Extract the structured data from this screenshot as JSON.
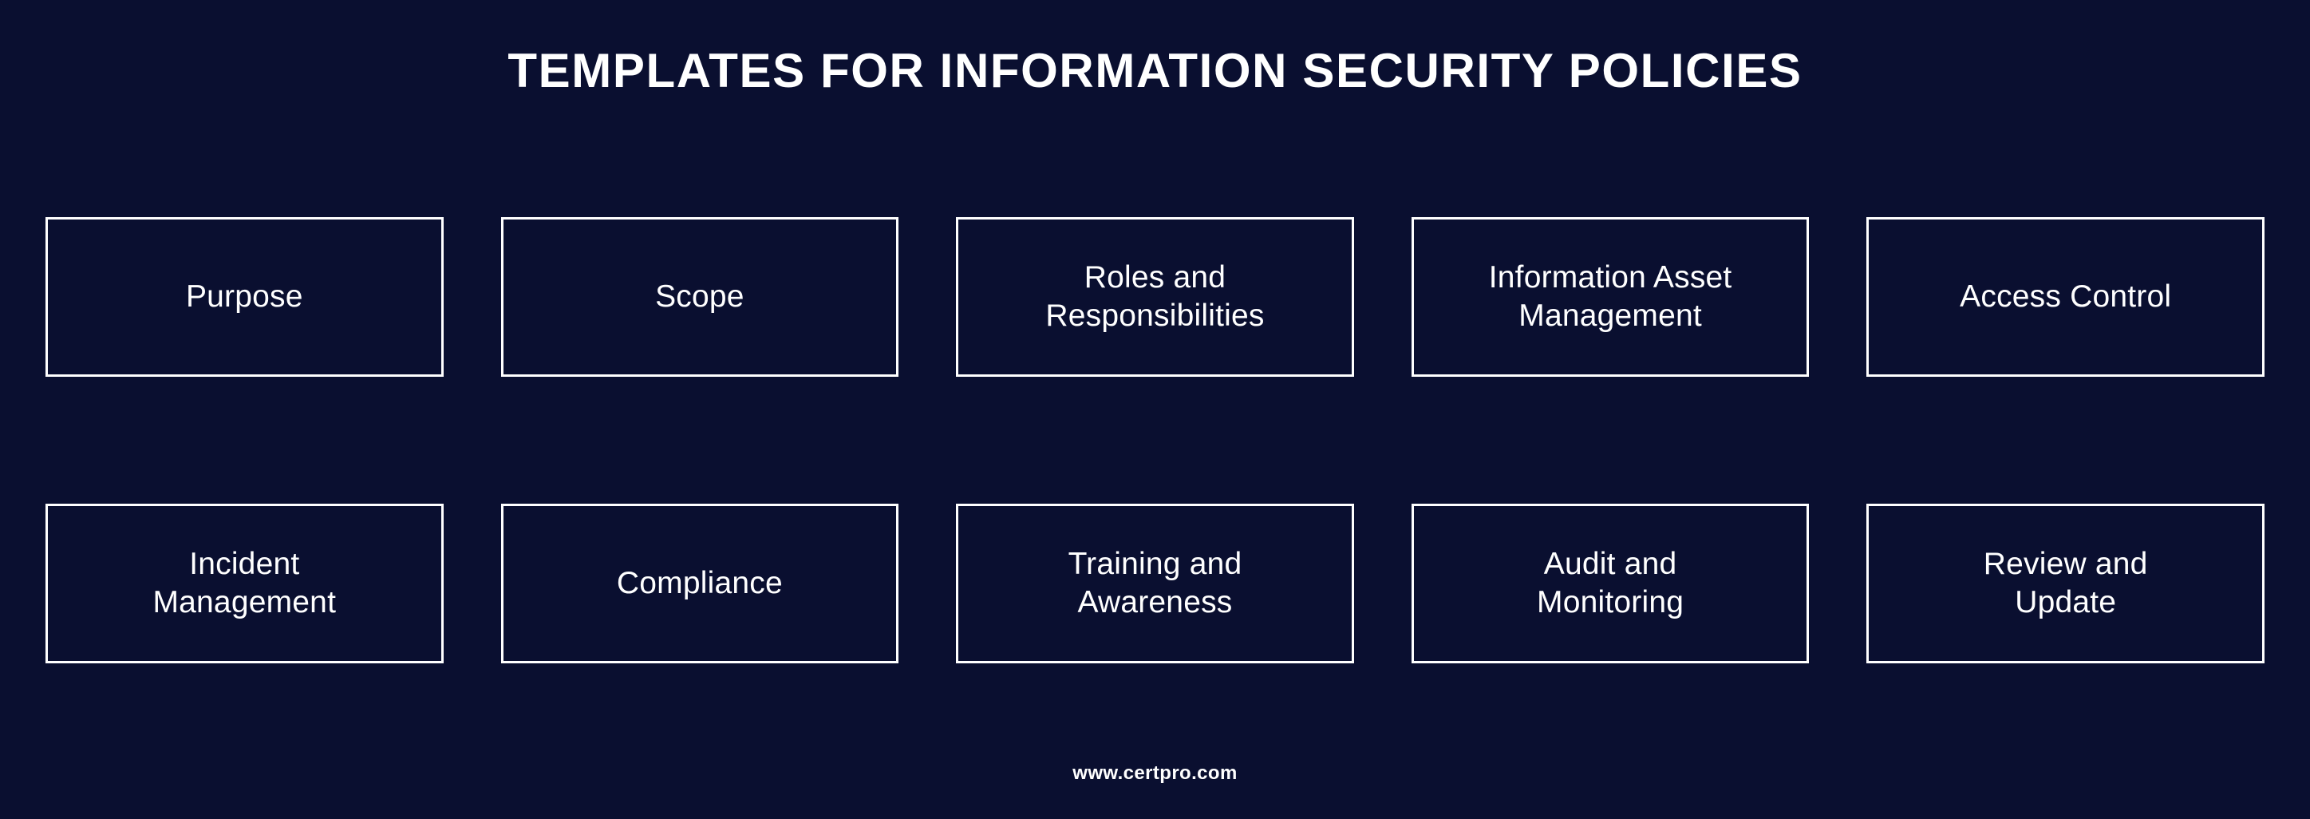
{
  "poster": {
    "title": "TEMPLATES FOR INFORMATION SECURITY POLICIES",
    "background_color": "#0a0f30",
    "text_color": "#ffffff",
    "border_color": "#ffffff",
    "footer_url": "www.certpro.com"
  },
  "rows": [
    {
      "tiles": [
        {
          "label": "Purpose"
        },
        {
          "label": "Scope"
        },
        {
          "label": "Roles and\nResponsibilities"
        },
        {
          "label": "Information Asset\nManagement"
        },
        {
          "label": "Access Control"
        }
      ]
    },
    {
      "tiles": [
        {
          "label": "Incident\nManagement"
        },
        {
          "label": "Compliance"
        },
        {
          "label": "Training and\nAwareness"
        },
        {
          "label": "Audit and\nMonitoring"
        },
        {
          "label": "Review and\nUpdate"
        }
      ]
    }
  ]
}
